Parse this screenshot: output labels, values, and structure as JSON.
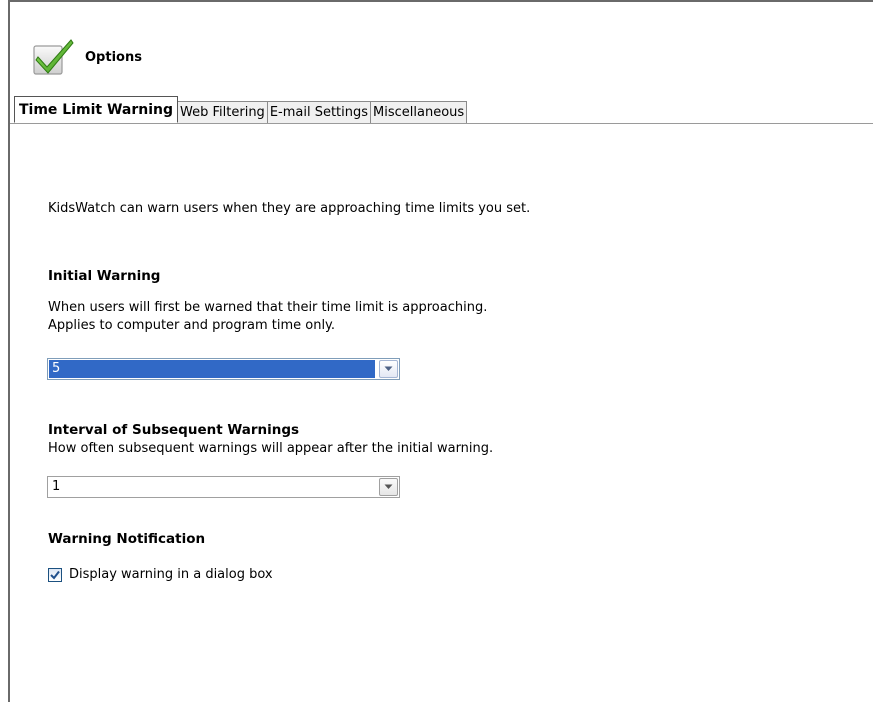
{
  "header": {
    "title": "Options",
    "icon": "checkmark-icon"
  },
  "tabs": [
    {
      "label": "Time Limit Warning",
      "active": true
    },
    {
      "label": "Web Filtering",
      "active": false
    },
    {
      "label": "E-mail Settings",
      "active": false
    },
    {
      "label": "Miscellaneous",
      "active": false
    }
  ],
  "intro_text": "KidsWatch can warn users when they are approaching time limits you set.",
  "initial_warning": {
    "title": "Initial Warning",
    "desc_line1": "When users will first be warned that their time limit is approaching.",
    "desc_line2": "Applies to computer and program time only.",
    "value": "5"
  },
  "interval": {
    "title": "Interval of Subsequent Warnings",
    "desc": "How often subsequent warnings will appear after the initial warning.",
    "value": "1"
  },
  "notification": {
    "title": "Warning Notification",
    "checkbox_label": "Display warning in a dialog box",
    "checked": true
  },
  "colors": {
    "selection": "#3169c6",
    "check_green": "#4caf2a",
    "checkbox_tick": "#1f4f8c"
  }
}
